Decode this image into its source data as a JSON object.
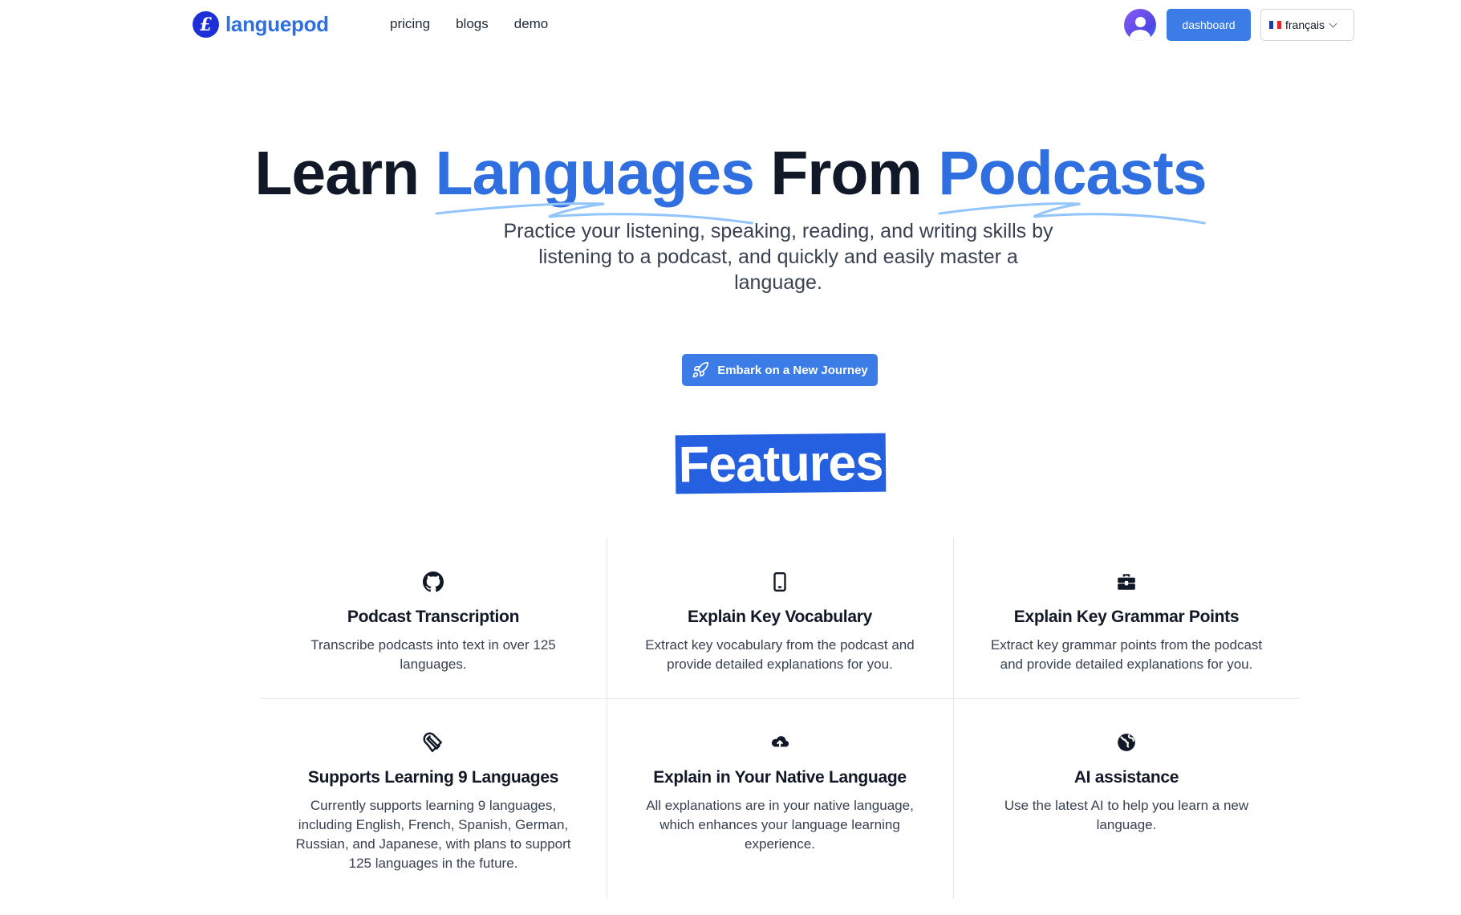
{
  "brand": {
    "logo_glyph": "£",
    "name": "languepod",
    "color": "#2f6fe0"
  },
  "nav": {
    "links": [
      "pricing",
      "blogs",
      "demo"
    ]
  },
  "header": {
    "dashboard_label": "dashboard",
    "language": {
      "flag": "fr-flag",
      "selected": "français"
    }
  },
  "hero": {
    "title_parts": [
      "Learn ",
      "Languages",
      " From ",
      "Podcasts"
    ],
    "subtitle": "Practice your listening, speaking, reading, and writing skills by listening to a podcast, and quickly and easily master a language.",
    "cta_label": "Embark on a New Journey",
    "cta_icon": "rocket-icon"
  },
  "features": {
    "heading": "Features",
    "items": [
      {
        "icon": "github-icon",
        "title": "Podcast Transcription",
        "description": "Transcribe podcasts into text in over 125 languages."
      },
      {
        "icon": "mobile-icon",
        "title": "Explain Key Vocabulary",
        "description": "Extract key vocabulary from the podcast and provide detailed explanations for you."
      },
      {
        "icon": "toolbox-icon",
        "title": "Explain Key Grammar Points",
        "description": "Extract key grammar points from the podcast and provide detailed explanations for you."
      },
      {
        "icon": "magnet-icon",
        "title": "Supports Learning 9 Languages",
        "description": "Currently supports learning 9 languages, including English, French, Spanish, German, Russian, and Japanese, with plans to support 125 languages in the future."
      },
      {
        "icon": "cloud-upload-icon",
        "title": "Explain in Your Native Language",
        "description": "All explanations are in your native language, which enhances your language learning experience."
      },
      {
        "icon": "globe-icon",
        "title": "AI assistance",
        "description": "Use the latest AI to help you learn a new language."
      }
    ]
  },
  "colors": {
    "accent": "#3b7ce6",
    "highlight": "#2560e0",
    "text": "#111827"
  }
}
